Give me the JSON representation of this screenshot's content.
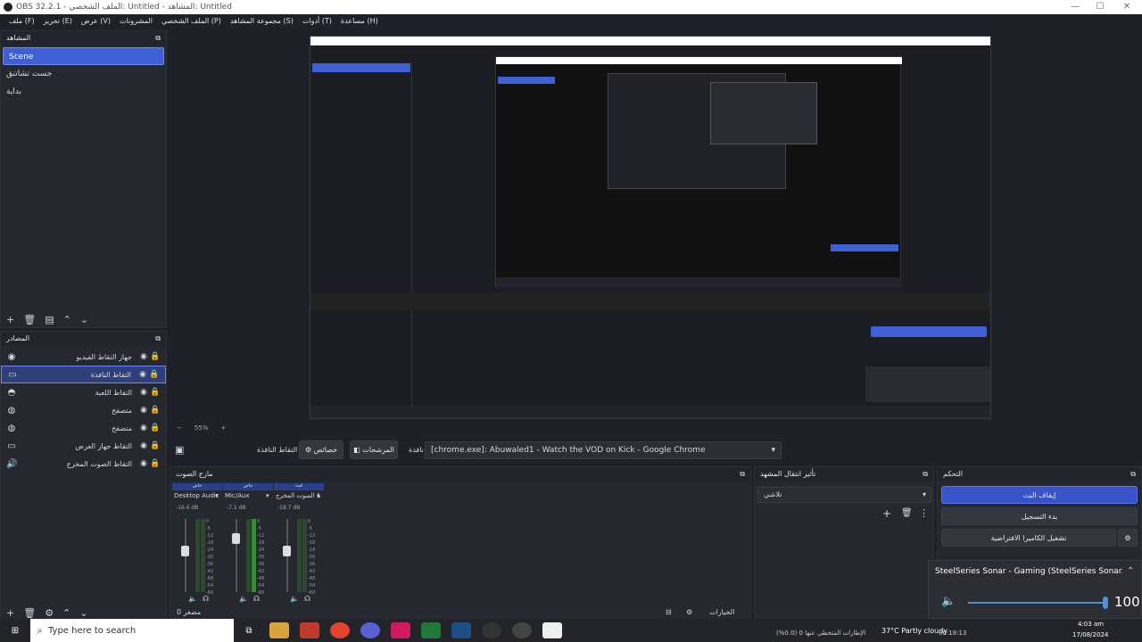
{
  "window": {
    "title": "OBS 32.2.1 - الملف الشخصي: Untitled - المشاهد: Untitled"
  },
  "menu": [
    "ملف (F)",
    "تحرير (E)",
    "عرض (V)",
    "المشرونات",
    "الملف الشخصي (P)",
    "مجموعة المشاهد (S)",
    "أدوات (T)",
    "مساعدة (H)"
  ],
  "scenes": {
    "title": "المشاهد",
    "items": [
      "Scene",
      "جست تشاتنق",
      "بداية"
    ]
  },
  "sources": {
    "title": "المصادر",
    "items": [
      {
        "label": "جهاز التقاط الفيديو",
        "icon": "camera-icon"
      },
      {
        "label": "التقاط النافذة",
        "icon": "window-icon"
      },
      {
        "label": "التقاط اللعبة",
        "icon": "gamepad-icon"
      },
      {
        "label": "متصفح",
        "icon": "globe-icon"
      },
      {
        "label": "متصفح",
        "icon": "globe-icon"
      },
      {
        "label": "التقاط جهاز العرض",
        "icon": "monitor-icon"
      },
      {
        "label": "التقاط الصوت المخرج",
        "icon": "speaker-icon"
      }
    ]
  },
  "preview_bar": {
    "zoom": "55%",
    "source_label": "التقاط النافذة",
    "properties": "خصائص",
    "filters": "المرشحات",
    "window_label": "نافذة",
    "window_value": "[chrome.exe]: Abuwaled1 - Watch the VOD on Kick - Google Chrome"
  },
  "mixer": {
    "title": "مازج الصوت",
    "channels": [
      {
        "name": "Desktop Audio",
        "db": "-16.6 dB",
        "tag": "خاص"
      },
      {
        "name": "Mic/Aux",
        "db": "-7.1 dB",
        "tag": "خاص"
      },
      {
        "name": "التقاط الصوت المخرج",
        "db": "-18.7 dB",
        "tag": "لعبة"
      }
    ],
    "scale": [
      "0",
      "-5",
      "-12",
      "-18",
      "-24",
      "-30",
      "-36",
      "-42",
      "-48",
      "-54",
      "-60"
    ]
  },
  "transitions": {
    "title": "تأثير انتقال المشهد",
    "value": "تلاشي"
  },
  "controls": {
    "title": "التحكم",
    "start_stream": "إيقاف البث",
    "start_record": "بدء التسجيل",
    "virtual_cam": "تشغيل الكاميرا الافتراضية"
  },
  "volume_popup": {
    "device": "SteelSeries Sonar - Gaming (SteelSeries Sonar...",
    "level": "100"
  },
  "status": {
    "dropped": "الإطارات المتخطى عنها 0 (0.0%)",
    "time": "00:18:13",
    "weather": "37°C Partly cloudy",
    "clock": "4:03 am",
    "date": "17/08/2024"
  },
  "search": {
    "placeholder": "Type here to search"
  },
  "extra": {
    "status_left": "مصغر 0",
    "filters_toggle": "الخيارات"
  }
}
